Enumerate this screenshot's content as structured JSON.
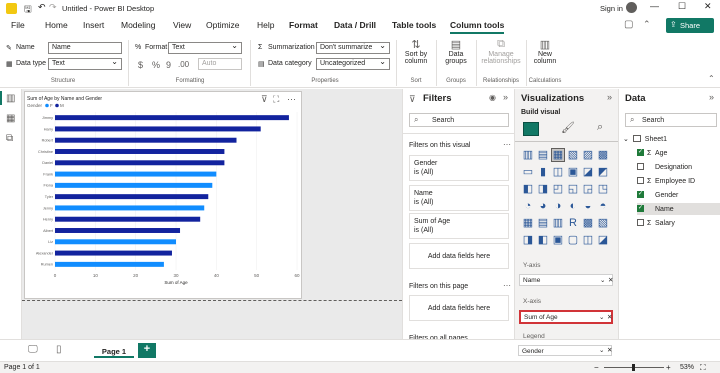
{
  "window": {
    "title": "Untitled - Power BI Desktop",
    "user": "Sign in"
  },
  "menu": {
    "file": "File",
    "home": "Home",
    "insert": "Insert",
    "modeling": "Modeling",
    "view": "View",
    "optimize": "Optimize",
    "help": "Help",
    "format": "Format",
    "data_drill": "Data / Drill",
    "table_tools": "Table tools",
    "column_tools": "Column tools",
    "share": "Share"
  },
  "ribbon": {
    "name_label": "Name",
    "name_value": "Name",
    "datatype_label": "Data type",
    "datatype_value": "Text",
    "structure": "Structure",
    "format_label": "Format",
    "format_value": "Text",
    "currency": "$",
    "percent": "%",
    "comma": "9",
    "decimal": ".00",
    "auto": "Auto",
    "formatting": "Formatting",
    "summarization_label": "Summarization",
    "summarization_value": "Don't summarize",
    "category_label": "Data category",
    "category_value": "Uncategorized",
    "properties": "Properties",
    "sort_label1": "Sort by",
    "sort_label2": "column",
    "sort_group": "Sort",
    "groups_label1": "Data",
    "groups_label2": "groups",
    "groups_group": "Groups",
    "rel_label1": "Manage",
    "rel_label2": "relationships",
    "rel_group": "Relationships",
    "newcol_label1": "New",
    "newcol_label2": "column",
    "calc_group": "Calculations"
  },
  "chart_data": {
    "type": "bar",
    "title": "Sum of Age by Name and Gender",
    "legend_title": "Gender",
    "legend": [
      "F",
      "M"
    ],
    "xlabel": "Sum of Age",
    "ylabel": "Name",
    "xlim": [
      0,
      60
    ],
    "xticks": [
      0,
      10,
      20,
      30,
      40,
      50,
      60
    ],
    "categories": [
      "Jimmy",
      "Harry",
      "Robert",
      "Christine",
      "Daniel",
      "Frank",
      "Fiona",
      "Tyler",
      "Jenny",
      "Henry",
      "Albert",
      "Liz",
      "Alexander",
      "Rumen"
    ],
    "colors": {
      "F": "#118dff",
      "M": "#12239e"
    },
    "genders": [
      "M",
      "M",
      "M",
      "M",
      "M",
      "F",
      "F",
      "M",
      "F",
      "M",
      "M",
      "F",
      "M",
      "F"
    ],
    "values": [
      58,
      51,
      45,
      42,
      42,
      40,
      39,
      38,
      37,
      36,
      31,
      30,
      29,
      27
    ]
  },
  "filters": {
    "title": "Filters",
    "search": "Search",
    "on_visual": "Filters on this visual",
    "cards": [
      {
        "name": "Gender",
        "value": "is (All)"
      },
      {
        "name": "Name",
        "value": "is (All)"
      },
      {
        "name": "Sum of Age",
        "value": "is (All)"
      }
    ],
    "add_fields": "Add data fields here",
    "on_page": "Filters on this page",
    "add_fields2": "Add data fields here",
    "on_all": "Filters on all pages"
  },
  "viz": {
    "title": "Visualizations",
    "build": "Build visual",
    "yaxis": "Y-axis",
    "yaxis_field": "Name",
    "xaxis": "X-axis",
    "xaxis_field": "Sum of Age",
    "legend": "Legend",
    "legend_field": "Gender"
  },
  "data": {
    "title": "Data",
    "search": "Search",
    "table": "Sheet1",
    "fields": [
      {
        "name": "Age",
        "checked": true,
        "sigma": true
      },
      {
        "name": "Designation",
        "checked": false,
        "sigma": false
      },
      {
        "name": "Employee ID",
        "checked": false,
        "sigma": true
      },
      {
        "name": "Gender",
        "checked": true,
        "sigma": false
      },
      {
        "name": "Name",
        "checked": true,
        "sigma": false
      },
      {
        "name": "Salary",
        "checked": false,
        "sigma": true
      }
    ]
  },
  "pages": {
    "tab": "Page 1",
    "add": "+"
  },
  "status": {
    "page": "Page 1 of 1",
    "zoom": "53%"
  }
}
